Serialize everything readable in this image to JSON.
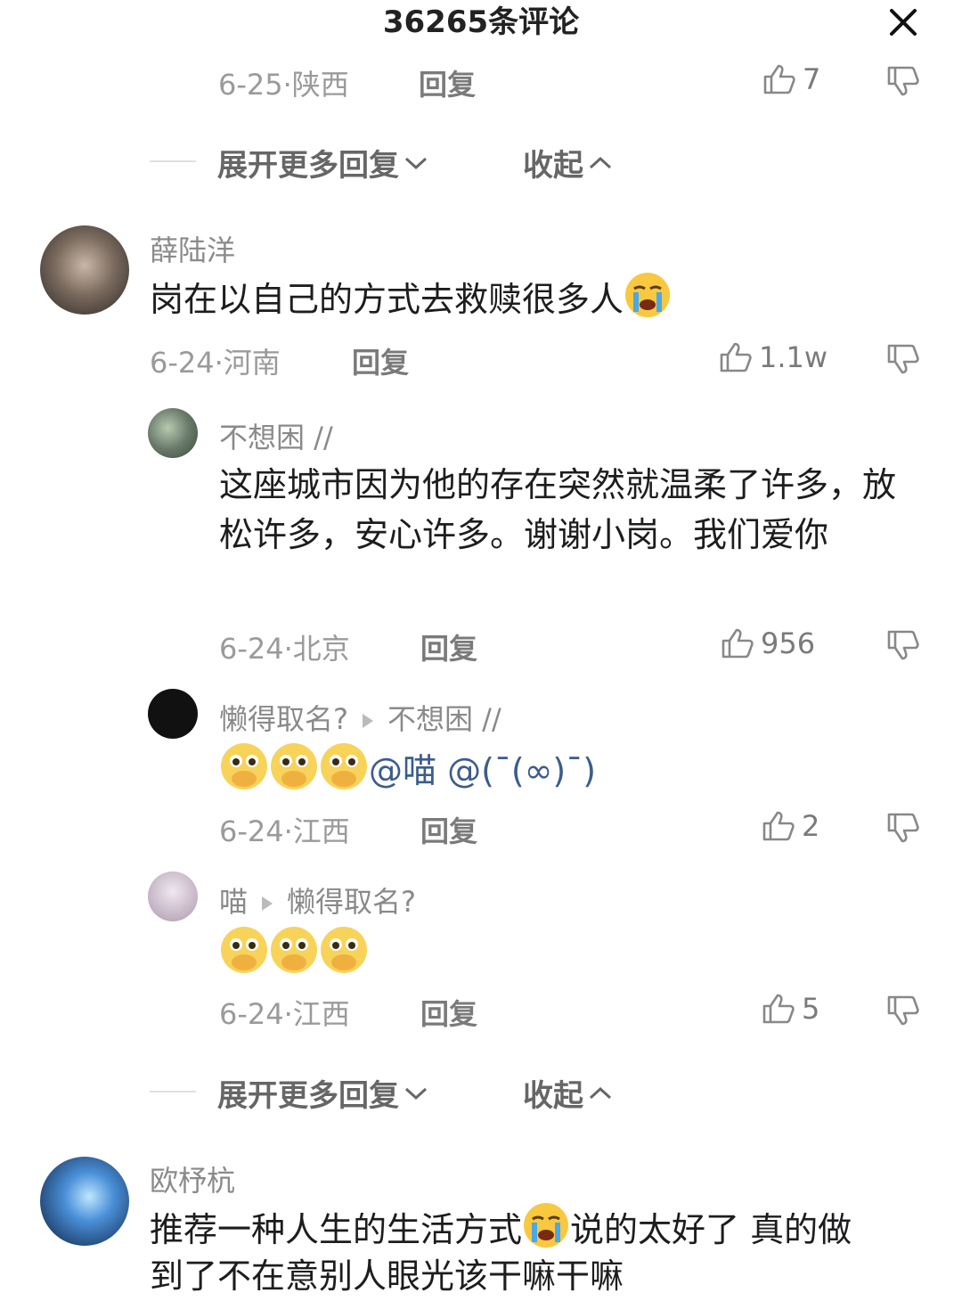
{
  "header": {
    "title": "36265条评论"
  },
  "top_reply": {
    "date": "6-25·陕西",
    "reply": "回复",
    "likes": "7"
  },
  "expand1": {
    "more": "展开更多回复",
    "collapse": "收起"
  },
  "comment1": {
    "user": "薛陆洋",
    "text": "岗在以自己的方式去救赎很多人",
    "date": "6-24·河南",
    "reply": "回复",
    "likes": "1.1w"
  },
  "reply1": {
    "user": "不想困 //",
    "text": "这座城市因为他的存在突然就温柔了许多，放松许多，安心许多。谢谢小岗。我们爱你",
    "date": "6-24·北京",
    "reply": "回复",
    "likes": "956"
  },
  "reply2": {
    "user": "懒得取名?",
    "target": "不想困 //",
    "mention": "@喵 @(ˉ(∞)ˉ)",
    "date": "6-24·江西",
    "reply": "回复",
    "likes": "2"
  },
  "reply3": {
    "user": "喵",
    "target": "懒得取名?",
    "date": "6-24·江西",
    "reply": "回复",
    "likes": "5"
  },
  "expand2": {
    "more": "展开更多回复",
    "collapse": "收起"
  },
  "comment2": {
    "user": "欧杼杭",
    "text_part1": "推荐一种人生的生活方式",
    "text_part2": "说的太好了 真的做",
    "text_line2": "到了不在意别人眼光该干嘛干嘛"
  },
  "colors": {
    "text": "#1d1d1f",
    "meta": "#9a9a9a",
    "mention": "#3c5c8c"
  }
}
